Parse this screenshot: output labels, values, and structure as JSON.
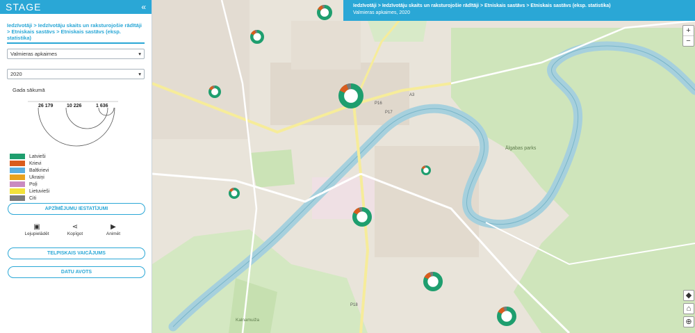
{
  "app": {
    "title": "STAGE",
    "collapse_icon": "double-chevron-left-icon"
  },
  "breadcrumb": "Iedzīvotāji > Iedzīvotāju skaits un raksturojošie rādītāji > Etniskais sastāvs > Etniskais sastāvs (eksp. statistika)",
  "filters": {
    "region": "Valmieras apkaimes",
    "year": "2020",
    "period_label": "Gada sākumā"
  },
  "size_legend": {
    "values": [
      "26 179",
      "10 226",
      "1 636"
    ]
  },
  "legend": [
    {
      "label": "Latvieši",
      "color": "#1e9e6e"
    },
    {
      "label": "Krievi",
      "color": "#d95c1e"
    },
    {
      "label": "Baltkrievi",
      "color": "#5aaee0"
    },
    {
      "label": "Ukraiņi",
      "color": "#e8a21f"
    },
    {
      "label": "Poļi",
      "color": "#c98bc0"
    },
    {
      "label": "Lietuvieši",
      "color": "#f2e23b"
    },
    {
      "label": "Citi",
      "color": "#7b7b7b"
    }
  ],
  "buttons": {
    "settings": "APZĪMĒJUMU IESTATĪJUMI",
    "spatial_query": "TELPISKAIS VAICĀJUMS",
    "data_source": "DATU AVOTS"
  },
  "tools": {
    "download": "Lejupielādēt",
    "share": "Kopīgot",
    "animate": "Animēt"
  },
  "topbar": {
    "path": "Iedzīvotāji > Iedzīvotāju skaits un raksturojošie rādītāji > Etniskais sastāvs > Etniskais sastāvs (eksp. statistika)",
    "subtitle": "Valmieras apkaimes, 2020"
  },
  "map_labels": {
    "park": "Ālgabas parks",
    "park2": "Kalnamuiža",
    "road_p16": "P16",
    "road_p17": "P17",
    "road_p18": "P18",
    "road_a3": "A3"
  },
  "zoom": {
    "in": "+",
    "out": "−"
  },
  "colors": {
    "accent": "#2aa7d6",
    "river": "#a9d3df",
    "forest": "#c8e3b4",
    "urban": "#e7dfd5"
  }
}
